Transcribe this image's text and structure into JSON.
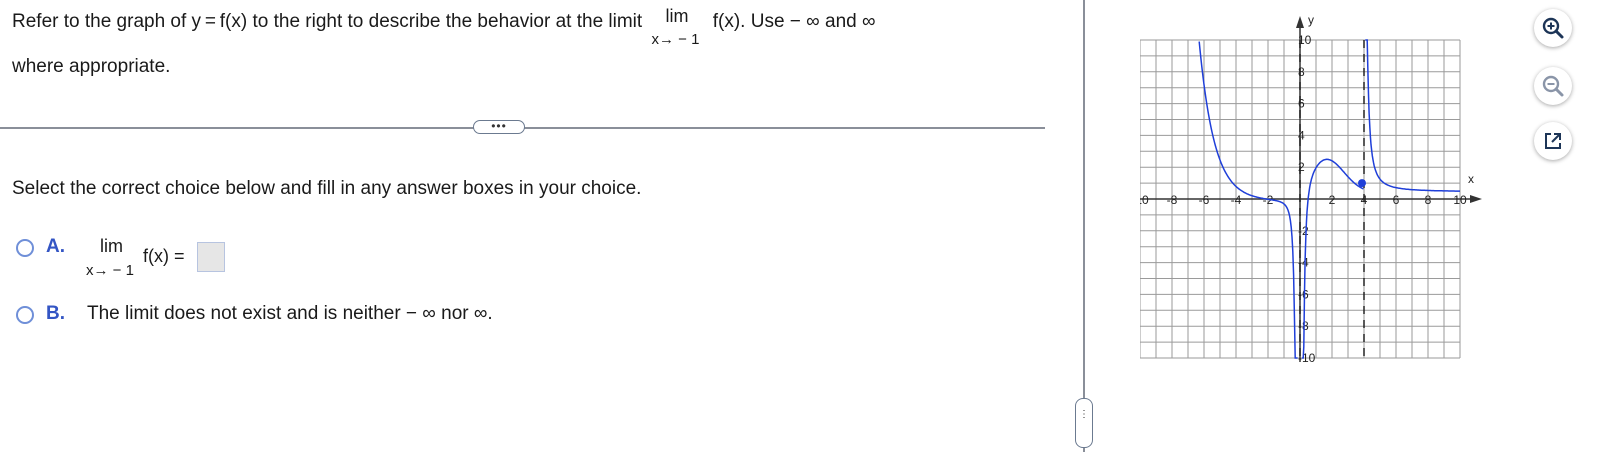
{
  "question": {
    "intro": "Refer to the graph of y = f(x) to the right to describe the behavior at the limit",
    "lim_word": "lim",
    "lim_sub": "x→ − 1",
    "after_limit": "f(x). Use  − ∞ and ∞",
    "line2": "where appropriate."
  },
  "more_button": "•••",
  "instruction": "Select the correct choice below and fill in any answer boxes in your choice.",
  "choices": {
    "a": {
      "letter": "A.",
      "lim_word": "lim",
      "lim_sub": "x→ − 1",
      "expr": "f(x) ="
    },
    "b": {
      "letter": "B.",
      "text": "The limit does not exist and is neither  − ∞ nor ∞."
    }
  },
  "side_handle": "⋮",
  "graph": {
    "x_label": "x",
    "y_label": "y",
    "x_ticks": [
      "-10",
      "-8",
      "-6",
      "-4",
      "-2",
      "2",
      "4",
      "6",
      "8",
      "10"
    ],
    "y_ticks": [
      "10",
      "8",
      "6",
      "4",
      "2",
      "-2",
      "-4",
      "-6",
      "-8",
      "-10"
    ],
    "x_range": [
      -10,
      10
    ],
    "y_range": [
      -10,
      10
    ],
    "grid": true,
    "asymptotes_x": [
      0,
      4
    ],
    "curve_color": "#1f3fd9",
    "point": [
      4,
      1
    ],
    "description_curves": "left branch from top near x=-6 descending to y≈0 at x≈-1.5 then dropping toward -inf as x->0-; middle branch from -inf near x=0+ rising to local max ≈2 at x≈1.5 down to point (4,1); right branch from +inf near x=4+ decreasing to y≈0.5"
  },
  "tools": [
    "zoom-in-icon",
    "zoom-out-icon",
    "popout-icon"
  ]
}
